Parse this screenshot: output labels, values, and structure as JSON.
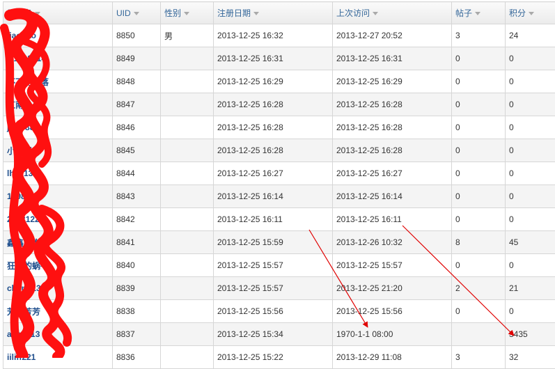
{
  "headers": {
    "username": "用户名",
    "uid": "UID",
    "gender": "性别",
    "reg_date": "注册日期",
    "last_visit": "上次访问",
    "posts": "帖子",
    "points": "积分"
  },
  "rows": [
    {
      "username": "iiaohao",
      "uid": "8850",
      "gender": "男",
      "reg": "2013-12-25 16:32",
      "last": "2013-12-27 20:52",
      "posts": "3",
      "points": "24"
    },
    {
      "username": "w1218014",
      "uid": "8849",
      "gender": "",
      "reg": "2013-12-25 16:31",
      "last": "2013-12-25 16:31",
      "posts": "0",
      "points": "0"
    },
    {
      "username": "不不的角落",
      "uid": "8848",
      "gender": "",
      "reg": "2013-12-25 16:29",
      "last": "2013-12-25 16:29",
      "posts": "0",
      "points": "0"
    },
    {
      "username": "江南小小",
      "uid": "8847",
      "gender": "",
      "reg": "2013-12-25 16:28",
      "last": "2013-12-25 16:28",
      "posts": "0",
      "points": "0"
    },
    {
      "username": "jerry88",
      "uid": "8846",
      "gender": "",
      "reg": "2013-12-25 16:28",
      "last": "2013-12-25 16:28",
      "posts": "0",
      "points": "0"
    },
    {
      "username": "小智慧",
      "uid": "8845",
      "gender": "",
      "reg": "2013-12-25 16:28",
      "last": "2013-12-25 16:28",
      "posts": "0",
      "points": "0"
    },
    {
      "username": "lh2013",
      "uid": "8844",
      "gender": "",
      "reg": "2013-12-25 16:27",
      "last": "2013-12-25 16:27",
      "posts": "0",
      "points": "0"
    },
    {
      "username": "15987347",
      "uid": "8843",
      "gender": "",
      "reg": "2013-12-25 16:14",
      "last": "2013-12-25 16:14",
      "posts": "0",
      "points": "0"
    },
    {
      "username": "20131224",
      "uid": "8842",
      "gender": "",
      "reg": "2013-12-25 16:11",
      "last": "2013-12-25 16:11",
      "posts": "0",
      "points": "0"
    },
    {
      "username": "鑫鑫的胸",
      "uid": "8841",
      "gender": "",
      "reg": "2013-12-25 15:59",
      "last": "2013-12-26 10:32",
      "posts": "8",
      "points": "45"
    },
    {
      "username": "狂奔的蜗牛",
      "uid": "8840",
      "gender": "",
      "reg": "2013-12-25 15:57",
      "last": "2013-12-25 15:57",
      "posts": "0",
      "points": "0"
    },
    {
      "username": "cheng1359",
      "uid": "8839",
      "gender": "",
      "reg": "2013-12-25 15:57",
      "last": "2013-12-25 21:20",
      "posts": "2",
      "points": "21"
    },
    {
      "username": "芳芳芳芳",
      "uid": "8838",
      "gender": "",
      "reg": "2013-12-25 15:56",
      "last": "2013-12-25 15:56",
      "posts": "0",
      "points": "0"
    },
    {
      "username": "abc2013",
      "uid": "8837",
      "gender": "",
      "reg": "2013-12-25 15:34",
      "last": "1970-1-1 08:00",
      "posts": "",
      "points": "3435"
    },
    {
      "username": "iiliff221",
      "uid": "8836",
      "gender": "",
      "reg": "2013-12-25 15:22",
      "last": "2013-12-29 11:08",
      "posts": "3",
      "points": "32"
    }
  ],
  "colors": {
    "annotation": "#e00000",
    "header_text": "#336699",
    "username_link": "#1f4e8c"
  }
}
